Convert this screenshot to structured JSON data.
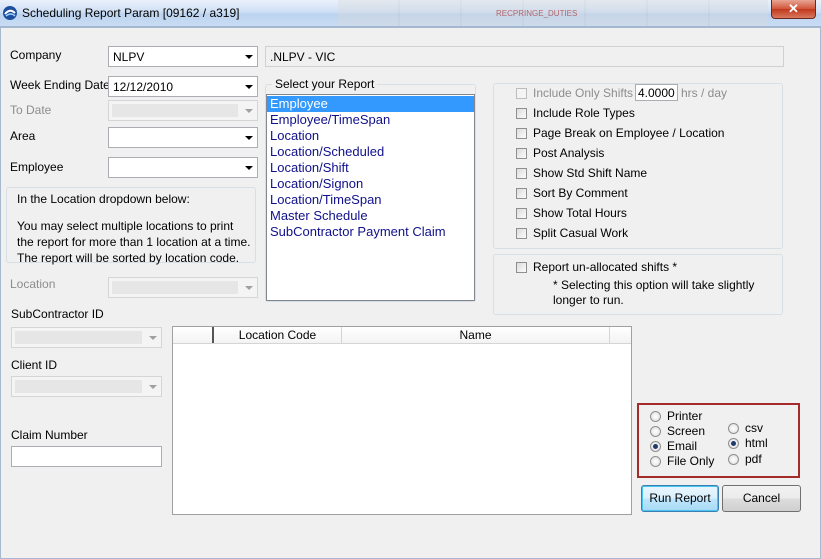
{
  "window": {
    "title": "Scheduling Report Param  [09162 / a319]",
    "background_tab_text": "RECPRINGE_DUTIES",
    "close_symbol": "✕"
  },
  "form": {
    "company_label": "Company",
    "company_value": "NLPV",
    "company_desc": ".NLPV - VIC",
    "week_ending_label": "Week Ending Date",
    "week_ending_value": "12/12/2010",
    "to_date_label": "To Date",
    "area_label": "Area",
    "employee_label": "Employee",
    "location_note_title": "In the Location dropdown below:",
    "location_note_body": "You may select multiple locations to print the report for more than 1 location at a time. The report will be sorted by location code.",
    "location_label": "Location",
    "subcontractor_label": "SubContractor ID",
    "client_label": "Client ID",
    "claim_label": "Claim Number"
  },
  "report_select": {
    "title": "Select your Report",
    "items": [
      "Employee",
      "Employee/TimeSpan",
      "Location",
      "Location/Scheduled",
      "Location/Shift",
      "Location/Signon",
      "Location/TimeSpan",
      "Master Schedule",
      "SubContractor Payment Claim"
    ],
    "selected": "Employee"
  },
  "options": {
    "include_only_shifts_label": "Include Only Shifts <",
    "shifts_value": "4.0000",
    "hrs_per_day_label": "hrs / day",
    "checkboxes": [
      "Include Role Types",
      "Page Break on Employee / Location",
      "Post Analysis",
      "Show Std Shift Name",
      "Sort By Comment",
      "Show Total Hours",
      "Split Casual Work"
    ],
    "unallocated_label": "Report un-allocated shifts  *",
    "unallocated_note": "* Selecting this option will take slightly longer to run."
  },
  "grid": {
    "columns": [
      "",
      "Location Code",
      "Name"
    ]
  },
  "output": {
    "destinations": [
      "Printer",
      "Screen",
      "Email",
      "File Only"
    ],
    "destination_selected": "Email",
    "formats": [
      "csv",
      "html",
      "pdf"
    ],
    "format_selected": "html"
  },
  "buttons": {
    "run": "Run Report",
    "cancel": "Cancel"
  },
  "colors": {
    "list_selection": "#3399ff",
    "list_text": "#10108c",
    "highlight_frame": "#a52a2a"
  }
}
